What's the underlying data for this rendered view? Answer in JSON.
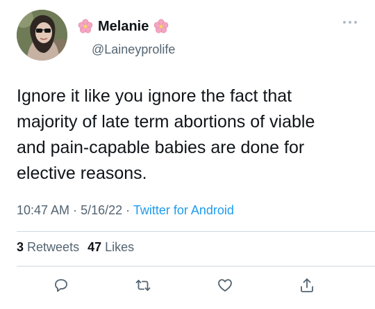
{
  "tweet": {
    "display_name": "Melanie",
    "handle": "@Laineyprolife",
    "text": "Ignore it like you ignore the fact that\nmajority of late term abortions of viable\nand pain-capable babies are done for\nelective reasons.",
    "time": "10:47 AM",
    "date": "5/16/22",
    "separator": "·",
    "source": "Twitter for Android",
    "retweets_count": "3",
    "retweets_label": "Retweets",
    "likes_count": "47",
    "likes_label": "Likes"
  },
  "icons": {
    "avatar": "profile-photo",
    "name_decoration_left": "cherry-blossom-icon",
    "name_decoration_right": "cherry-blossom-icon",
    "more": "more-options-icon",
    "reply": "reply-icon",
    "retweet": "retweet-icon",
    "like": "heart-icon",
    "share": "share-icon"
  },
  "colors": {
    "text": "#0f1419",
    "secondary": "#536471",
    "link": "#1d9bf0",
    "blossom": "#f4a6c1",
    "divider": "#cfd9de"
  }
}
